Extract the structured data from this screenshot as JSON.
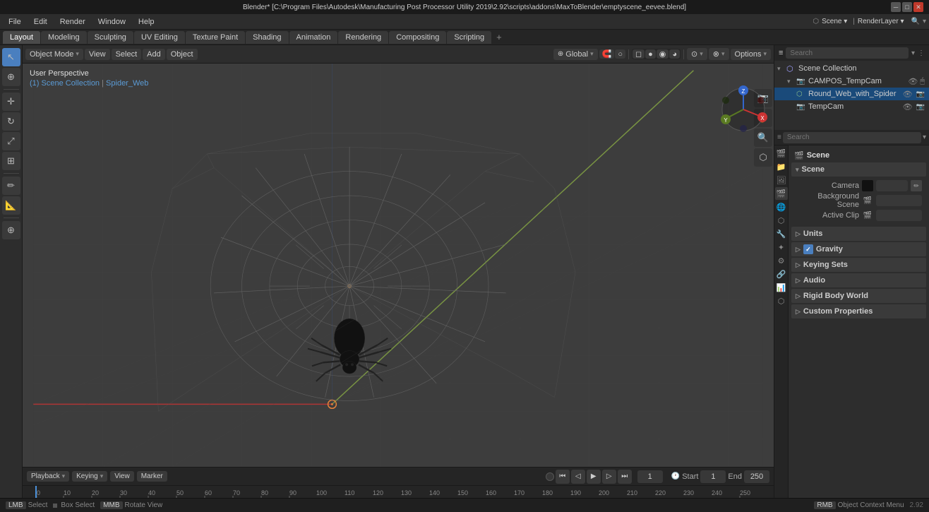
{
  "titlebar": {
    "text": "Blender* [C:\\Program Files\\Autodesk\\Manufacturing Post Processor Utility 2019\\2.92\\scripts\\addons\\MaxToBlender\\emptyscene_eevee.blend]"
  },
  "menubar": {
    "items": [
      "File",
      "Edit",
      "Render",
      "Window",
      "Help"
    ]
  },
  "workspace_tabs": {
    "tabs": [
      "Layout",
      "Modeling",
      "Sculpting",
      "UV Editing",
      "Texture Paint",
      "Shading",
      "Animation",
      "Rendering",
      "Compositing",
      "Scripting"
    ],
    "active": "Layout",
    "plus_label": "+"
  },
  "viewport": {
    "mode_label": "Object Mode",
    "view_label": "View",
    "select_label": "Select",
    "add_label": "Add",
    "object_label": "Object",
    "perspective_label": "User Perspective",
    "breadcrumb_collection": "(1) Scene Collection",
    "breadcrumb_object": "Spider_Web",
    "global_label": "Global",
    "options_label": "Options"
  },
  "gizmo": {
    "x_label": "X",
    "y_label": "Y",
    "z_label": "Z"
  },
  "outliner": {
    "title": "Scene Collection",
    "items": [
      {
        "label": "CAMPOS_TempCam",
        "type": "camera",
        "icon": "📷",
        "indent": 1
      },
      {
        "label": "Round_Web_with_Spider",
        "type": "mesh",
        "icon": "⬡",
        "indent": 1
      },
      {
        "label": "TempCam",
        "type": "camera",
        "icon": "📷",
        "indent": 1
      }
    ]
  },
  "properties": {
    "title": "Scene",
    "search_placeholder": "Search",
    "sections": [
      {
        "id": "scene",
        "label": "Scene",
        "expanded": true,
        "rows": [
          {
            "label": "Camera",
            "value": "",
            "has_square": true,
            "has_edit": true
          },
          {
            "label": "Background Scene",
            "value": "",
            "has_icon": true
          },
          {
            "label": "Active Clip",
            "value": "",
            "has_icon": true
          }
        ]
      },
      {
        "id": "units",
        "label": "Units",
        "expanded": false,
        "rows": []
      },
      {
        "id": "gravity",
        "label": "Gravity",
        "expanded": true,
        "rows": [],
        "has_checkbox": true
      },
      {
        "id": "keying_sets",
        "label": "Keying Sets",
        "expanded": false,
        "rows": []
      },
      {
        "id": "audio",
        "label": "Audio",
        "expanded": false,
        "rows": []
      },
      {
        "id": "rigid_body_world",
        "label": "Rigid Body World",
        "expanded": false,
        "rows": []
      },
      {
        "id": "custom_properties",
        "label": "Custom Properties",
        "expanded": false,
        "rows": []
      }
    ],
    "icons": {
      "render": "🎬",
      "output": "📁",
      "view_layer": "🖼",
      "scene": "🎬",
      "world": "🌐",
      "object": "⬡",
      "particles": "✦",
      "physics": "⚙",
      "constraints": "🔗",
      "modifiers": "🔧",
      "shader": "⬡",
      "data": "📊"
    }
  },
  "timeline": {
    "playback_label": "Playback",
    "keying_label": "Keying",
    "view_label": "View",
    "marker_label": "Marker",
    "current_frame": "1",
    "start_frame_label": "Start",
    "start_frame": "1",
    "end_frame_label": "End",
    "end_frame": "250",
    "tick_marks": [
      "0",
      "10",
      "20",
      "30",
      "40",
      "50",
      "60",
      "70",
      "80",
      "90",
      "100",
      "110",
      "120",
      "130",
      "140",
      "150",
      "160",
      "170",
      "180",
      "190",
      "200",
      "210",
      "220",
      "230",
      "240",
      "250"
    ],
    "play_btn": "▶",
    "prev_btn": "⏮",
    "next_btn": "⏭",
    "stop_btn": "⏹",
    "jump_start_btn": "⏪",
    "jump_end_btn": "⏩"
  },
  "statusbar": {
    "select_label": "Select",
    "box_select_label": "Box Select",
    "middle_label": "Middle Mouse",
    "rotate_label": "Rotate View",
    "context_label": "Object Context Menu",
    "version": "2.92"
  },
  "colors": {
    "accent_blue": "#4a90d9",
    "active_orange": "#e8823a",
    "bg_dark": "#252525",
    "bg_mid": "#2d2d2d",
    "bg_light": "#3a3a3a",
    "text_normal": "#cccccc",
    "text_dim": "#888888",
    "grid_line": "#444444",
    "x_axis": "#cc3333",
    "y_axis": "#88aa44",
    "z_axis": "#3366cc",
    "breadcrumb_blue": "#5b9bd5"
  },
  "left_tools": {
    "tools": [
      {
        "id": "select",
        "symbol": "↖",
        "active": true
      },
      {
        "id": "cursor",
        "symbol": "⊕"
      },
      {
        "id": "move",
        "symbol": "✛"
      },
      {
        "id": "rotate",
        "symbol": "↻"
      },
      {
        "id": "scale",
        "symbol": "⤢"
      },
      {
        "id": "transform",
        "symbol": "⊞"
      },
      {
        "id": "annotate",
        "symbol": "✏"
      },
      {
        "id": "measure",
        "symbol": "📏"
      },
      {
        "id": "add",
        "symbol": "⊕"
      }
    ]
  }
}
